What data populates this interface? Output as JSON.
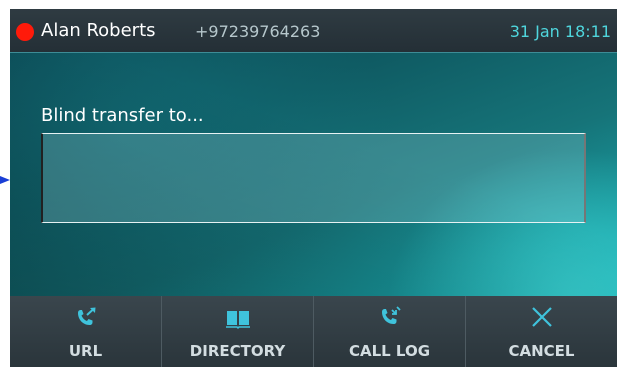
{
  "status_bar": {
    "caller_name": "Alan Roberts",
    "caller_number": "+97239764263",
    "date_time": "31 Jan 18:11",
    "status_color": "#ff1a0a"
  },
  "transfer": {
    "prompt": "Blind transfer to...",
    "value": "",
    "placeholder": ""
  },
  "softkeys": [
    {
      "label": "URL",
      "icon": "phone-transfer-icon"
    },
    {
      "label": "DIRECTORY",
      "icon": "book-icon"
    },
    {
      "label": "CALL LOG",
      "icon": "call-log-icon"
    },
    {
      "label": "CANCEL",
      "icon": "close-icon"
    }
  ],
  "colors": {
    "accent": "#4fd6dd",
    "icon": "#3fc3dc",
    "softkey_text": "#d3dde1"
  }
}
